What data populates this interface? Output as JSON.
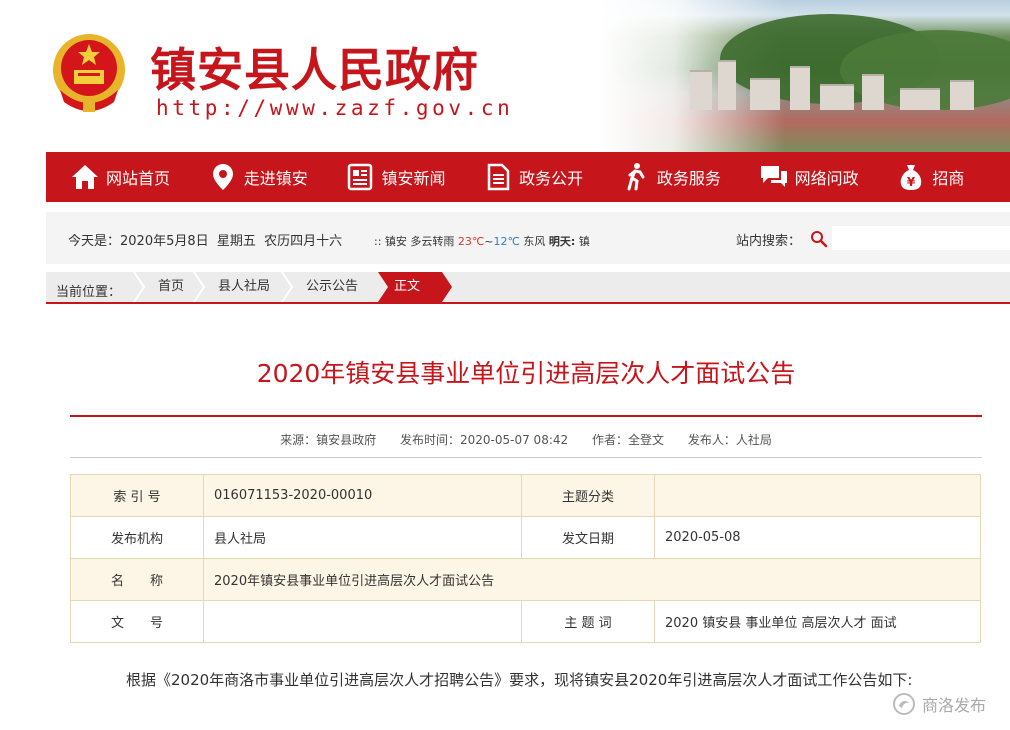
{
  "header": {
    "site_title": "镇安县人民政府",
    "site_url": "http://www.zazf.gov.cn"
  },
  "nav": {
    "items": [
      {
        "label": "网站首页",
        "icon": "home-icon"
      },
      {
        "label": "走进镇安",
        "icon": "location-pin-icon"
      },
      {
        "label": "镇安新闻",
        "icon": "newspaper-icon"
      },
      {
        "label": "政务公开",
        "icon": "document-icon"
      },
      {
        "label": "政务服务",
        "icon": "walking-person-icon"
      },
      {
        "label": "网络问政",
        "icon": "chat-bubbles-icon"
      },
      {
        "label": "招商",
        "icon": "money-bag-icon"
      }
    ]
  },
  "infobar": {
    "date": "今天是：2020年5月8日  星期五  农历四月十六",
    "weather_prefix": ":: 镇安 多云转雨 ",
    "temp_high": "23℃",
    "tilde": "~",
    "temp_low": "12℃",
    "wind": " 东风 ",
    "tomorrow_label": "明天:",
    "tomorrow_value": " 镇",
    "search_label": "站内搜索：",
    "search_placeholder": ""
  },
  "breadcrumb": {
    "label": "当前位置：",
    "items": [
      "首页",
      "县人社局",
      "公示公告"
    ],
    "current": "正文"
  },
  "article": {
    "title": "2020年镇安县事业单位引进高层次人才面试公告",
    "meta": {
      "source": "来源：镇安县政府",
      "publish_time": "发布时间：2020-05-07 08:42",
      "author": "作者：全登文",
      "publisher": "发布人：人社局"
    },
    "info_table": {
      "index_label": "索 引 号",
      "index_value": "016071153-2020-00010",
      "category_label": "主题分类",
      "category_value": "",
      "org_label": "发布机构",
      "org_value": "县人社局",
      "date_label": "发文日期",
      "date_value": "2020-05-08",
      "name_label": "名　　称",
      "name_value": "2020年镇安县事业单位引进高层次人才面试公告",
      "docno_label": "文　　号",
      "docno_value": "",
      "keywords_label": "主 题 词",
      "keywords_value": "2020 镇安县 事业单位 高层次人才 面试"
    },
    "body": "根据《2020年商洛市事业单位引进高层次人才招聘公告》要求，现将镇安县2020年引进高层次人才面试工作公告如下:"
  },
  "watermark": {
    "text": "商洛发布"
  },
  "colors": {
    "brand_red": "#c6161c",
    "table_stripe": "#fdf6e6",
    "table_border": "#e6d8b7"
  }
}
